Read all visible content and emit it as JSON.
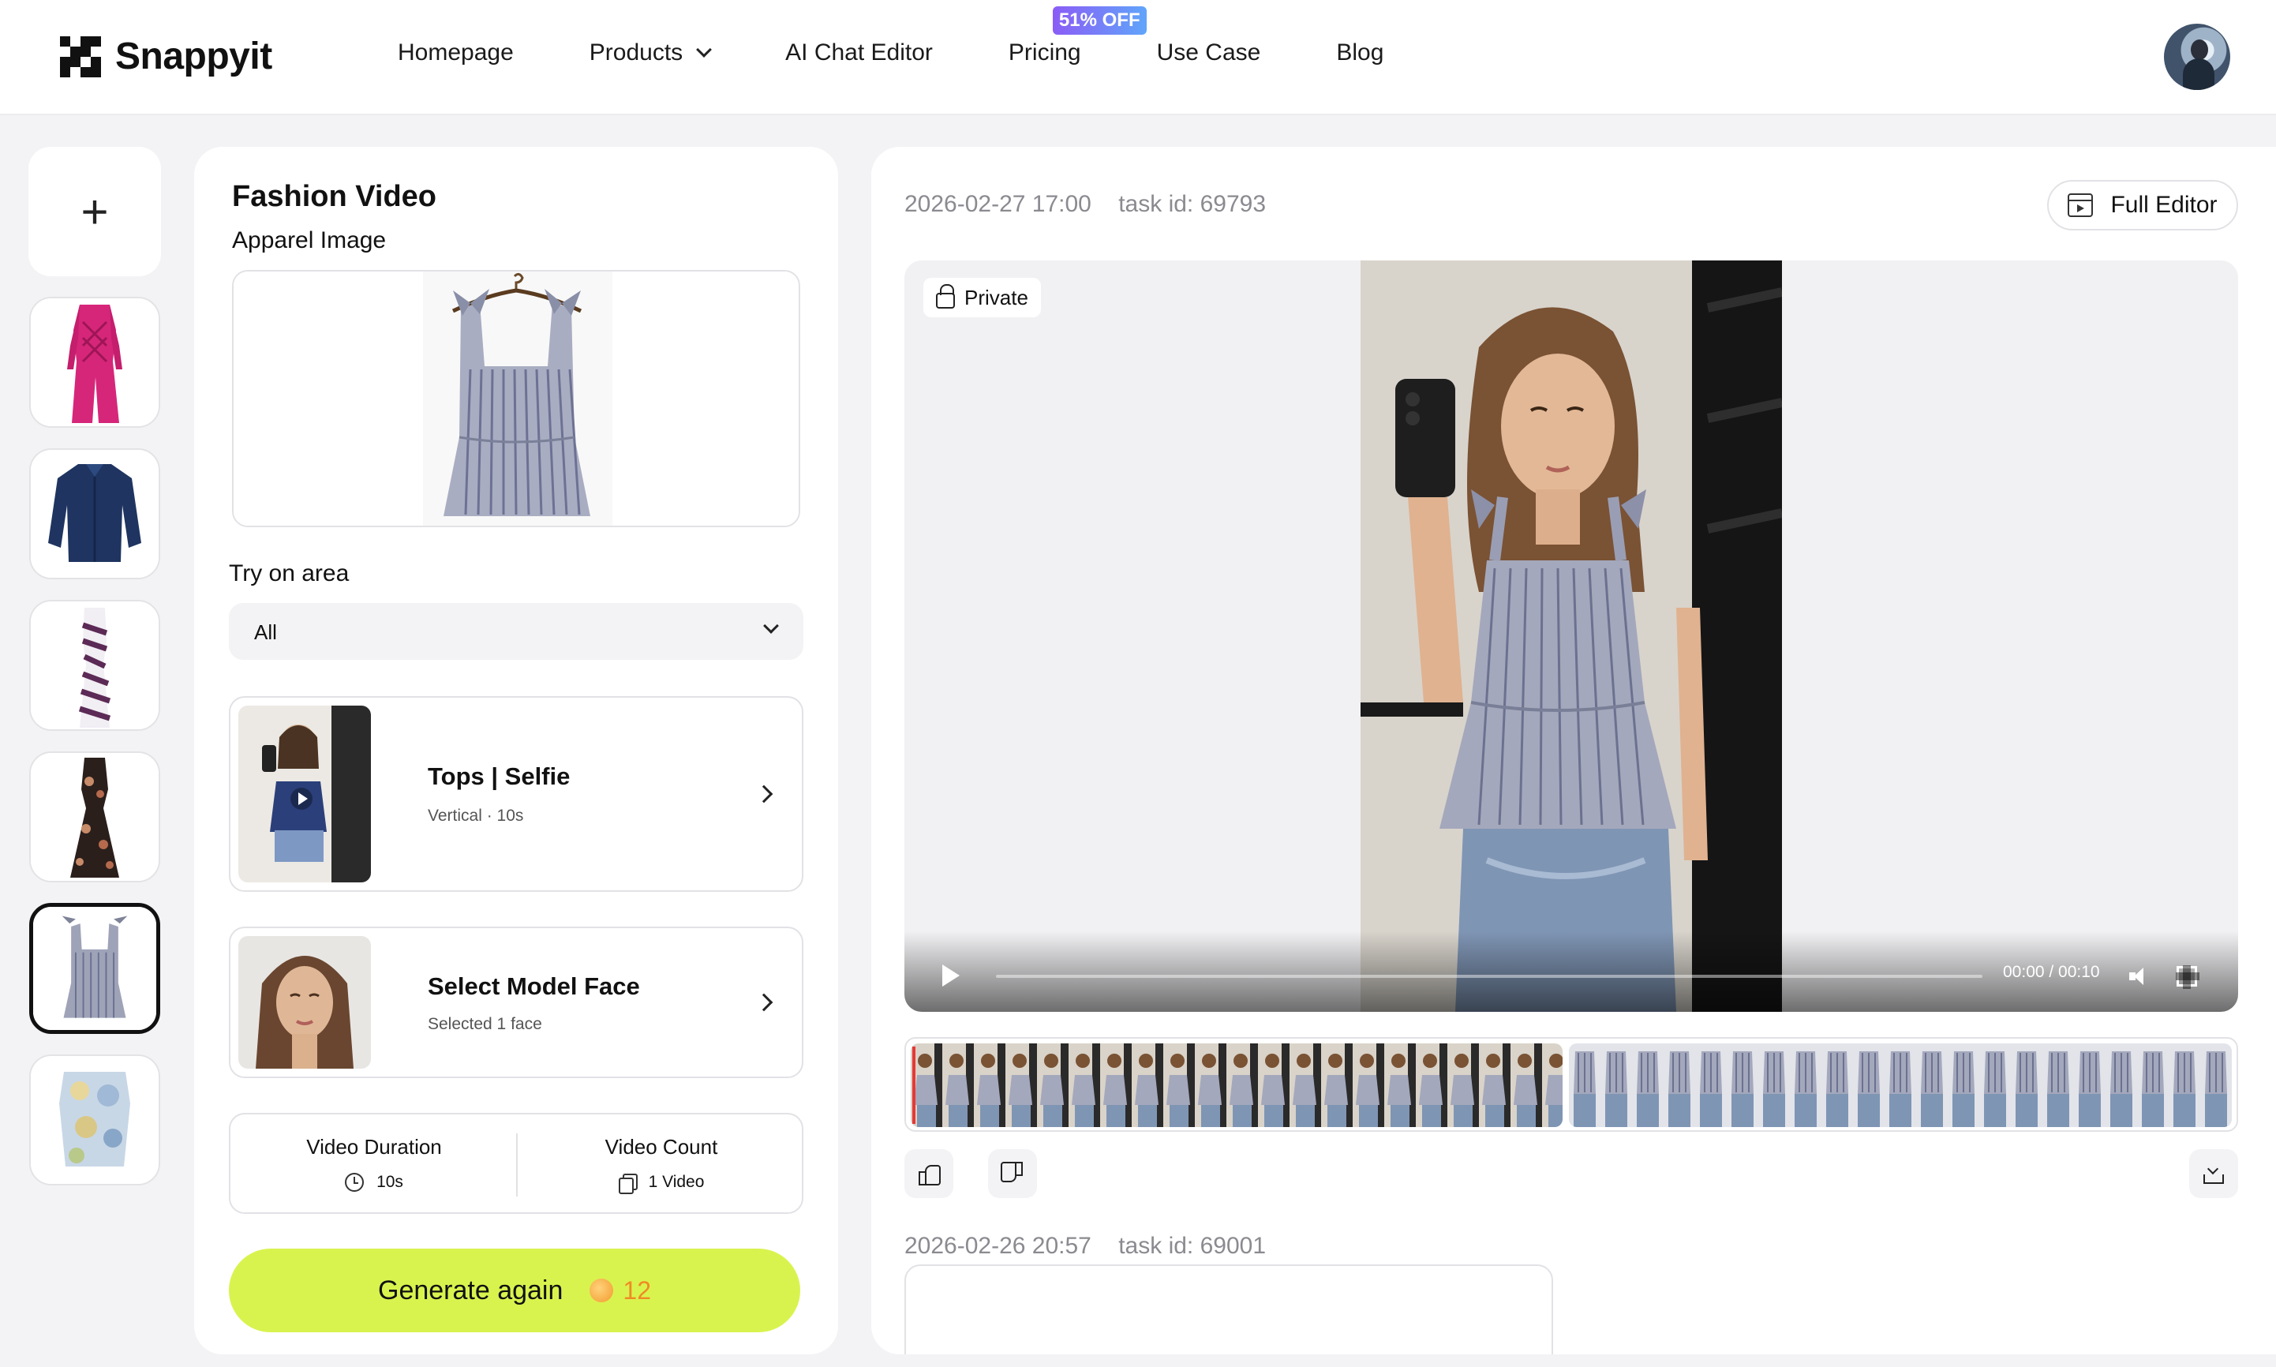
{
  "app": {
    "name": "Snappyit"
  },
  "nav": {
    "items": [
      "Homepage",
      "Products",
      "AI Chat Editor",
      "Pricing",
      "Use Case",
      "Blog"
    ],
    "pricing_badge": "51% OFF"
  },
  "form": {
    "title": "Fashion Video",
    "apparel_label": "Apparel Image",
    "try_on_label": "Try on area",
    "try_on_value": "All",
    "template": {
      "title": "Tops | Selfie",
      "subtitle": "Vertical · 10s"
    },
    "model": {
      "title": "Select Model Face",
      "subtitle": "Selected 1 face"
    },
    "duration": {
      "label": "Video Duration",
      "value": "10s"
    },
    "count": {
      "label": "Video Count",
      "value": "1 Video"
    },
    "generate_label": "Generate again",
    "credits": "12"
  },
  "result": {
    "current": {
      "date": "2026-02-27 17:00",
      "task": "task id: 69793"
    },
    "full_editor_label": "Full Editor",
    "private_label": "Private",
    "video_time": "00:00 / 00:10",
    "previous": {
      "date": "2026-02-26 20:57",
      "task": "task id: 69001"
    }
  },
  "colors": {
    "accent": "#d9f34e",
    "credit": "#f08a24",
    "badge_from": "#8b5cf6",
    "badge_to": "#60a5fa"
  },
  "icons": [
    "add-icon",
    "lock-icon",
    "play-icon",
    "mute-icon",
    "fullscreen-icon",
    "thumbs-up-icon",
    "thumbs-down-icon",
    "download-icon",
    "clock-icon",
    "copy-icon",
    "editor-icon",
    "chevron-down-icon",
    "chevron-right-icon",
    "coin-icon"
  ]
}
